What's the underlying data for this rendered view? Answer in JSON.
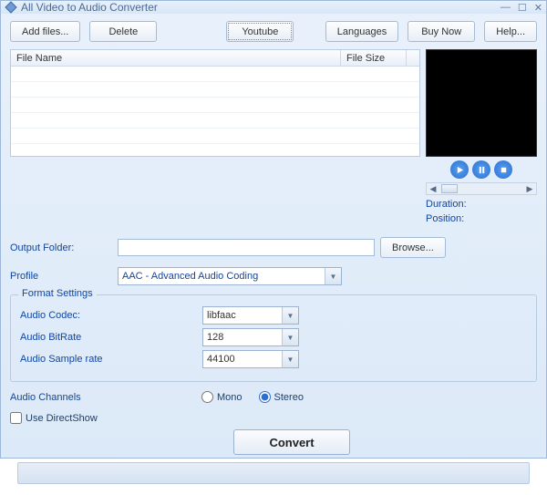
{
  "window": {
    "title": "All Video to Audio Converter"
  },
  "toolbar": {
    "add_files": "Add files...",
    "delete": "Delete",
    "youtube": "Youtube",
    "languages": "Languages",
    "buy_now": "Buy Now",
    "help": "Help..."
  },
  "table": {
    "col_name": "File Name",
    "col_size": "File Size",
    "rows": []
  },
  "preview": {
    "duration_label": "Duration:",
    "position_label": "Position:"
  },
  "output": {
    "label": "Output Folder:",
    "value": "",
    "browse": "Browse..."
  },
  "profile": {
    "label": "Profile",
    "value": "AAC - Advanced Audio Coding"
  },
  "format": {
    "legend": "Format Settings",
    "codec_label": "Audio Codec:",
    "codec_value": "libfaac",
    "bitrate_label": "Audio BitRate",
    "bitrate_value": "128",
    "sample_label": "Audio Sample rate",
    "sample_value": "44100"
  },
  "channels": {
    "label": "Audio Channels",
    "mono": "Mono",
    "stereo": "Stereo",
    "selected": "stereo"
  },
  "directshow": {
    "label": "Use DirectShow",
    "checked": false
  },
  "convert": {
    "label": "Convert"
  }
}
